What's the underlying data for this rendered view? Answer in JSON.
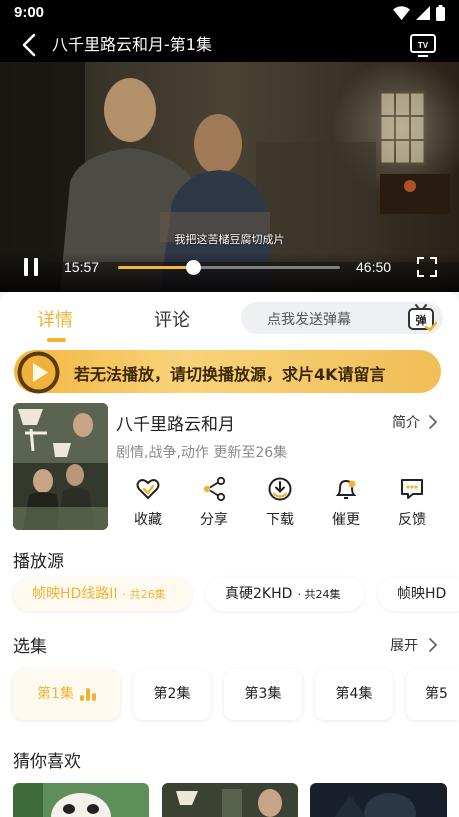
{
  "status_bar": {
    "time": "9:00"
  },
  "header": {
    "title": "八千里路云和月-第1集"
  },
  "player": {
    "subtitle": "我把这苦槠豆腐切成片",
    "current_time": "15:57",
    "total_time": "46:50",
    "progress": 0.34
  },
  "tabs": [
    {
      "label": "详情",
      "active": true
    },
    {
      "label": "评论",
      "active": false
    }
  ],
  "danmaku": {
    "placeholder": "点我发送弹幕",
    "icon_label": "弹"
  },
  "notice": {
    "text": "若无法播放，请切换播放源，求片4K请留言"
  },
  "show": {
    "title": "八千里路云和月",
    "intro_label": "简介",
    "meta": "剧情,战争,动作 更新至26集",
    "actions": [
      {
        "label": "收藏",
        "icon": "heart-icon"
      },
      {
        "label": "分享",
        "icon": "share-icon"
      },
      {
        "label": "下载",
        "icon": "download-icon"
      },
      {
        "label": "催更",
        "icon": "bell-icon"
      },
      {
        "label": "反馈",
        "icon": "feedback-icon"
      }
    ]
  },
  "sources": {
    "title": "播放源",
    "items": [
      {
        "name": "帧映HD线路II",
        "count": "· 共26集",
        "active": true
      },
      {
        "name": "真硬2KHD",
        "count": "· 共24集",
        "active": false
      },
      {
        "name": "帧映HD",
        "count": "",
        "active": false
      }
    ]
  },
  "episodes": {
    "title": "选集",
    "expand_label": "展开",
    "items": [
      "第1集",
      "第2集",
      "第3集",
      "第4集",
      "第5"
    ],
    "active_index": 0
  },
  "recommend": {
    "title": "猜你喜欢"
  },
  "colors": {
    "accent": "#f3b233",
    "notice_gold": "#f2b640"
  }
}
